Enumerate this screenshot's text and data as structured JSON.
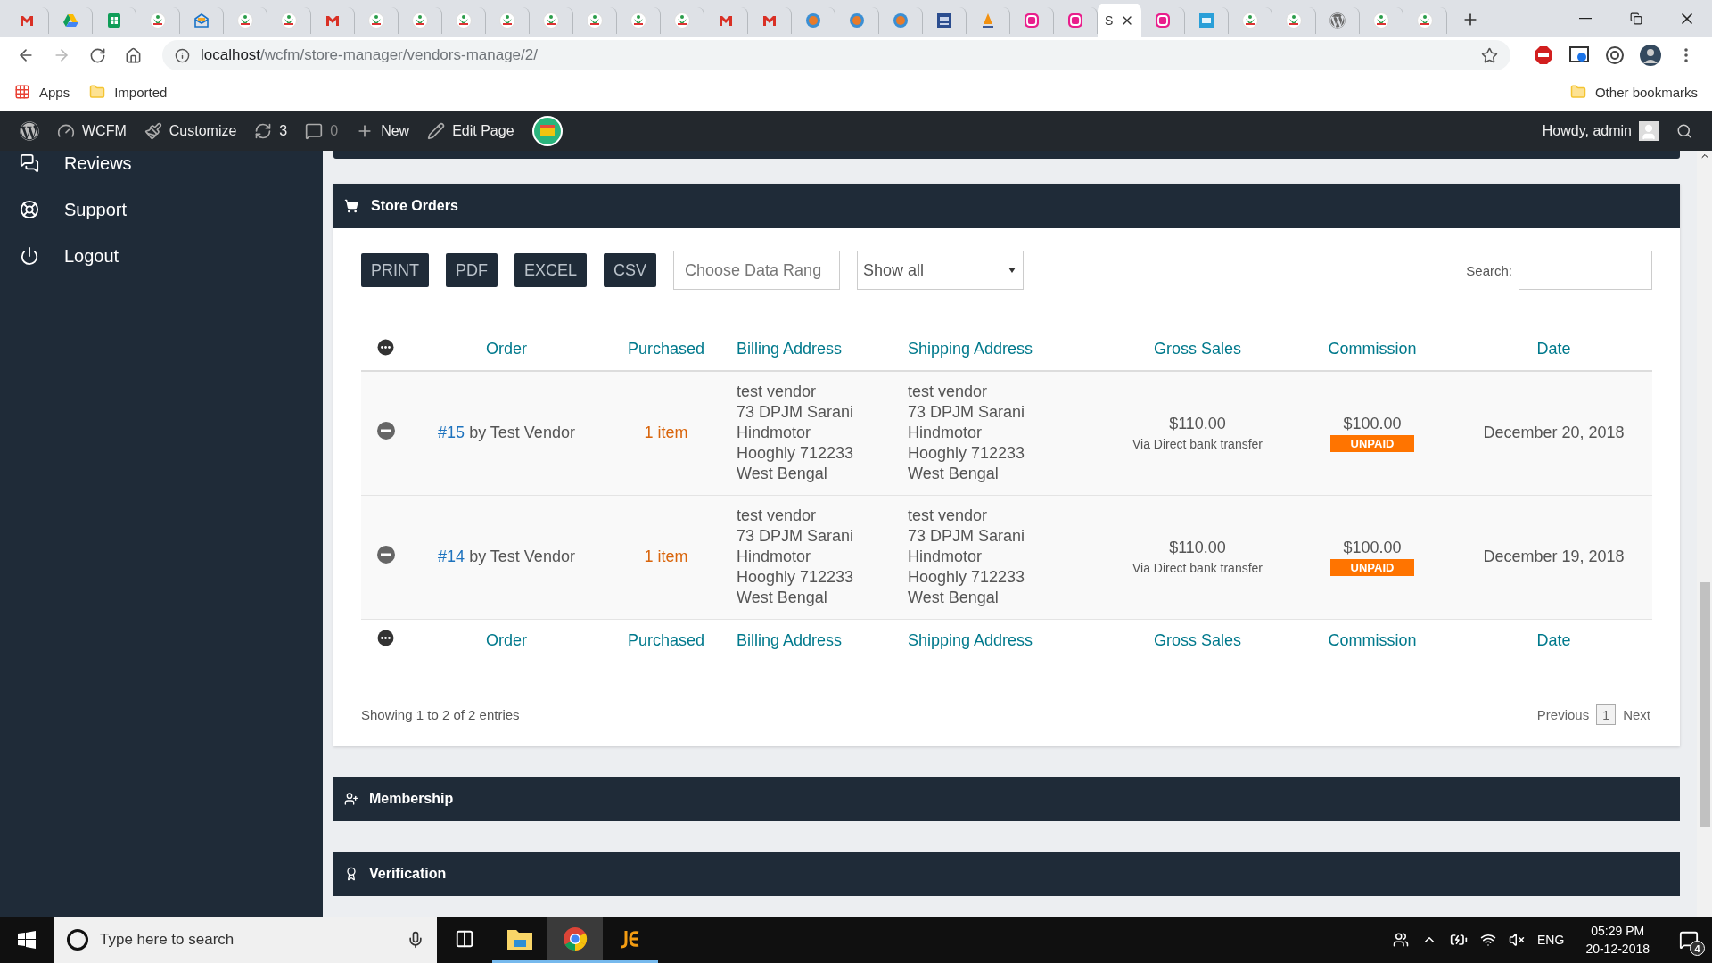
{
  "browser": {
    "tabs": [
      {
        "kind": "gmail",
        "selected": false
      },
      {
        "kind": "drive",
        "selected": false
      },
      {
        "kind": "sheets",
        "selected": false
      },
      {
        "kind": "wcfm",
        "selected": false
      },
      {
        "kind": "envelope",
        "selected": false
      },
      {
        "kind": "wcfm",
        "selected": false
      },
      {
        "kind": "wcfm",
        "selected": false
      },
      {
        "kind": "gmail",
        "selected": false
      },
      {
        "kind": "wcfm",
        "selected": false
      },
      {
        "kind": "wcfm",
        "selected": false
      },
      {
        "kind": "wcfm",
        "selected": false
      },
      {
        "kind": "wcfm",
        "selected": false
      },
      {
        "kind": "wcfm",
        "selected": false
      },
      {
        "kind": "wcfm",
        "selected": false
      },
      {
        "kind": "wcfm",
        "selected": false
      },
      {
        "kind": "wcfm",
        "selected": false
      },
      {
        "kind": "gmail",
        "selected": false
      },
      {
        "kind": "gmail",
        "selected": false
      },
      {
        "kind": "gear",
        "selected": false
      },
      {
        "kind": "gear",
        "selected": false
      },
      {
        "kind": "gear",
        "selected": false
      },
      {
        "kind": "square",
        "selected": false
      },
      {
        "kind": "sail",
        "selected": false
      },
      {
        "kind": "wamp",
        "selected": false
      },
      {
        "kind": "wamp",
        "selected": false
      },
      {
        "kind": "page",
        "title": "S",
        "selected": true
      },
      {
        "kind": "wamp",
        "selected": false
      },
      {
        "kind": "ibb",
        "selected": false
      },
      {
        "kind": "wcfm",
        "selected": false
      },
      {
        "kind": "wcfm",
        "selected": false
      },
      {
        "kind": "wordpress",
        "selected": false
      },
      {
        "kind": "wcfm",
        "selected": false
      },
      {
        "kind": "wcfm",
        "selected": false
      }
    ],
    "address": {
      "host": "localhost",
      "path": "/wcfm/store-manager/vendors-manage/2/"
    },
    "bookmarks": [
      {
        "kind": "apps",
        "label": "Apps"
      },
      {
        "kind": "folder",
        "label": "Imported"
      }
    ],
    "other_bookmarks": "Other bookmarks"
  },
  "admin_bar": {
    "items": [
      {
        "kind": "wordpress"
      },
      {
        "kind": "dashboard",
        "label": "WCFM"
      },
      {
        "kind": "brush",
        "label": "Customize"
      },
      {
        "kind": "updates",
        "label": "3"
      },
      {
        "kind": "comments",
        "label": "0"
      },
      {
        "kind": "plus",
        "label": "New"
      },
      {
        "kind": "pencil",
        "label": "Edit Page"
      },
      {
        "kind": "store"
      }
    ],
    "greeting": "Howdy, admin"
  },
  "sidebar": {
    "items": [
      {
        "kind": "reviews",
        "label": "Reviews"
      },
      {
        "kind": "support",
        "label": "Support"
      },
      {
        "kind": "logout",
        "label": "Logout"
      }
    ]
  },
  "store_orders": {
    "title": "Store Orders",
    "export_buttons": [
      "PRINT",
      "PDF",
      "EXCEL",
      "CSV"
    ],
    "date_range": {
      "placeholder": "Choose Data Rang"
    },
    "filter": {
      "value": "Show all"
    },
    "search": {
      "label": "Search:"
    },
    "columns": [
      "Order",
      "Purchased",
      "Billing Address",
      "Shipping Address",
      "Gross Sales",
      "Commission",
      "Date"
    ],
    "rows": [
      {
        "order_number": "#15",
        "vendor": "by Test Vendor",
        "purchased": "1 item",
        "billing": [
          "test vendor",
          "73 DPJM Sarani",
          "Hindmotor",
          "Hooghly 712233",
          "West Bengal"
        ],
        "shipping": [
          "test vendor",
          "73 DPJM Sarani",
          "Hindmotor",
          "Hooghly 712233",
          "West Bengal"
        ],
        "gross_sales": "$110.00",
        "payment": "Via Direct bank transfer",
        "commission": "$100.00",
        "status": "UNPAID",
        "date": "December 20, 2018"
      },
      {
        "order_number": "#14",
        "vendor": "by Test Vendor",
        "purchased": "1 item",
        "billing": [
          "test vendor",
          "73 DPJM Sarani",
          "Hindmotor",
          "Hooghly 712233",
          "West Bengal"
        ],
        "shipping": [
          "test vendor",
          "73 DPJM Sarani",
          "Hindmotor",
          "Hooghly 712233",
          "West Bengal"
        ],
        "gross_sales": "$110.00",
        "payment": "Via Direct bank transfer",
        "commission": "$100.00",
        "status": "UNPAID",
        "date": "December 19, 2018"
      }
    ],
    "footer_columns": [
      "Order",
      "Purchased",
      "Billing Address",
      "Shipping Address",
      "Gross Sales",
      "Commission",
      "Date"
    ],
    "info": "Showing 1 to 2 of 2 entries",
    "pagination": {
      "previous": "Previous",
      "pages": [
        {
          "label": "1",
          "selected": true
        }
      ],
      "next": "Next"
    }
  },
  "sections": [
    {
      "kind": "membership",
      "title": "Membership"
    },
    {
      "kind": "verification",
      "title": "Verification"
    }
  ],
  "taskbar": {
    "search": {
      "placeholder": "Type here to search"
    },
    "apps": [
      {
        "kind": "taskview",
        "running": false,
        "selected": false
      },
      {
        "kind": "explorer",
        "running": true,
        "selected": false
      },
      {
        "kind": "chrome",
        "running": true,
        "selected": true
      },
      {
        "kind": "jedit",
        "running": true,
        "selected": false
      }
    ],
    "language": "ENG",
    "time": "05:29 PM",
    "date": "20-12-2018",
    "notifications": "4"
  }
}
